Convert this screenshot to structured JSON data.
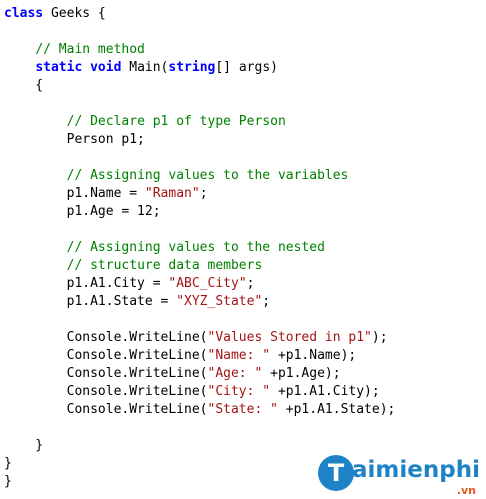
{
  "code": {
    "lines": [
      "class Geeks {",
      "",
      "    // Main method",
      "    static void Main(string[] args)",
      "    {",
      "",
      "        // Declare p1 of type Person",
      "        Person p1;",
      "",
      "        // Assigning values to the variables",
      "        p1.Name = \"Raman\";",
      "        p1.Age = 12;",
      "",
      "        // Assigning values to the nested",
      "        // structure data members",
      "        p1.A1.City = \"ABC_City\";",
      "        p1.A1.State = \"XYZ_State\";",
      "",
      "        Console.WriteLine(\"Values Stored in p1\");",
      "        Console.WriteLine(\"Name: \" +p1.Name);",
      "        Console.WriteLine(\"Age: \" +p1.Age);",
      "        Console.WriteLine(\"City: \" +p1.A1.City);",
      "        Console.WriteLine(\"State: \" +p1.A1.State);",
      "",
      "    }",
      "}",
      "}"
    ],
    "keywords": [
      "class",
      "static",
      "void",
      "string"
    ],
    "colors": {
      "keyword": "#0000ff",
      "comment": "#008000",
      "string": "#a31515",
      "text": "#000000"
    }
  },
  "watermark": {
    "icon_letter": "T",
    "brand": "aimienphi",
    "suffix": ".vn",
    "icon": "taimienphi-logo-icon",
    "colors": {
      "brand": "#1d82c6",
      "suffix": "#e35a1d"
    }
  }
}
